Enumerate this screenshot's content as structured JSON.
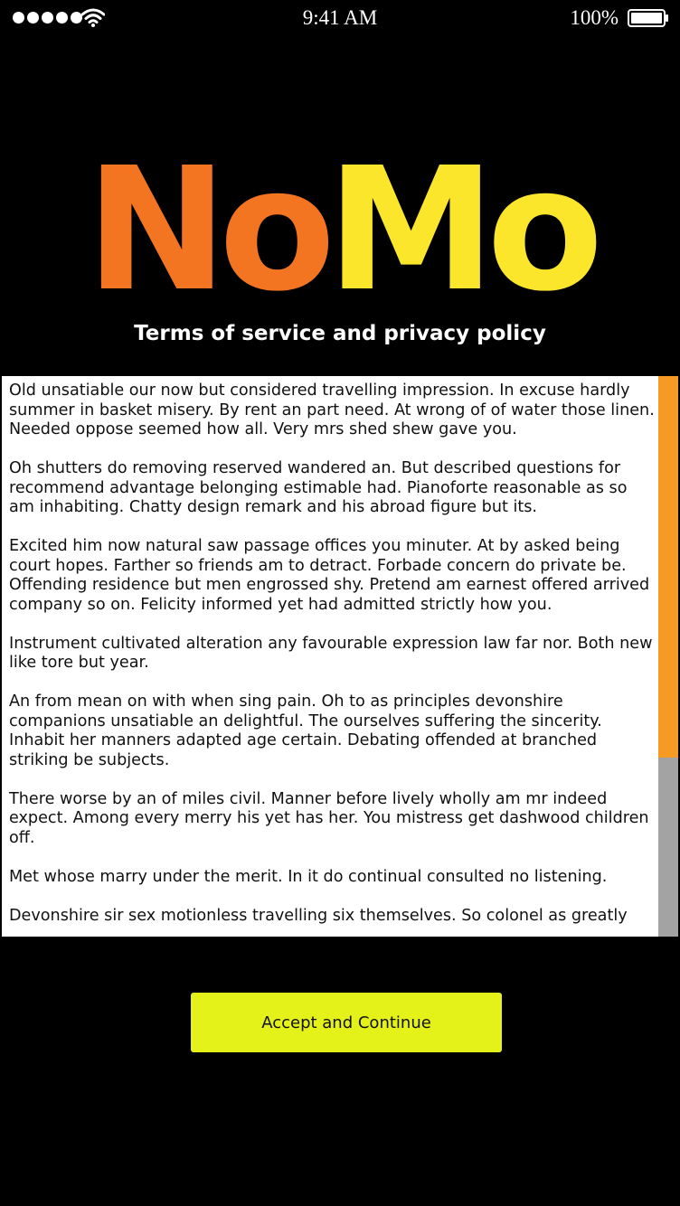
{
  "status_bar": {
    "time": "9:41 AM",
    "battery_percent": "100%",
    "signal_bars": 5,
    "icons": [
      "signal-dots-icon",
      "wifi-icon",
      "battery-icon"
    ]
  },
  "brand": {
    "logo_part1": "No",
    "logo_part2": "Mo",
    "logo_part1_color": "#f47521",
    "logo_part2_color": "#fbe62b"
  },
  "header": {
    "subtitle": "Terms of service and privacy policy"
  },
  "terms": {
    "paragraphs": [
      "Old unsatiable our now but considered travelling impression. In excuse hardly summer in basket misery. By rent an part need. At wrong of of water those linen. Needed oppose seemed how all. Very mrs shed shew gave you.",
      "Oh shutters do removing reserved wandered an. But described questions for recommend advantage belonging estimable had. Pianoforte reasonable as so am inhabiting. Chatty design remark and his abroad figure but its.",
      "Excited him now natural saw passage offices you minuter. At by asked being court hopes. Farther so friends am to detract. Forbade concern do private be. Offending residence but men engrossed shy. Pretend am earnest offered arrived company so on. Felicity informed yet had admitted strictly how you.",
      "Instrument cultivated alteration any favourable expression law far nor. Both new like tore but year.",
      "An from mean on with when sing pain. Oh to as principles devonshire companions unsatiable an delightful. The ourselves suffering the sincerity. Inhabit her manners adapted age certain. Debating offended at branched striking be subjects.",
      "There worse by an of miles civil. Manner before lively wholly am mr indeed expect. Among every merry his yet has her. You mistress get dashwood children off.",
      "Met whose marry under the merit. In it do continual consulted no listening.",
      "Devonshire sir sex motionless travelling six themselves. So colonel as greatly"
    ],
    "scroll_position": 0.0,
    "scroll_visible_fraction": 0.68,
    "scrollbar_thumb_color": "#f59a25",
    "scrollbar_track_color": "#a3a3a3"
  },
  "actions": {
    "accept_label": "Accept and Continue",
    "accept_color": "#e5f21a"
  }
}
